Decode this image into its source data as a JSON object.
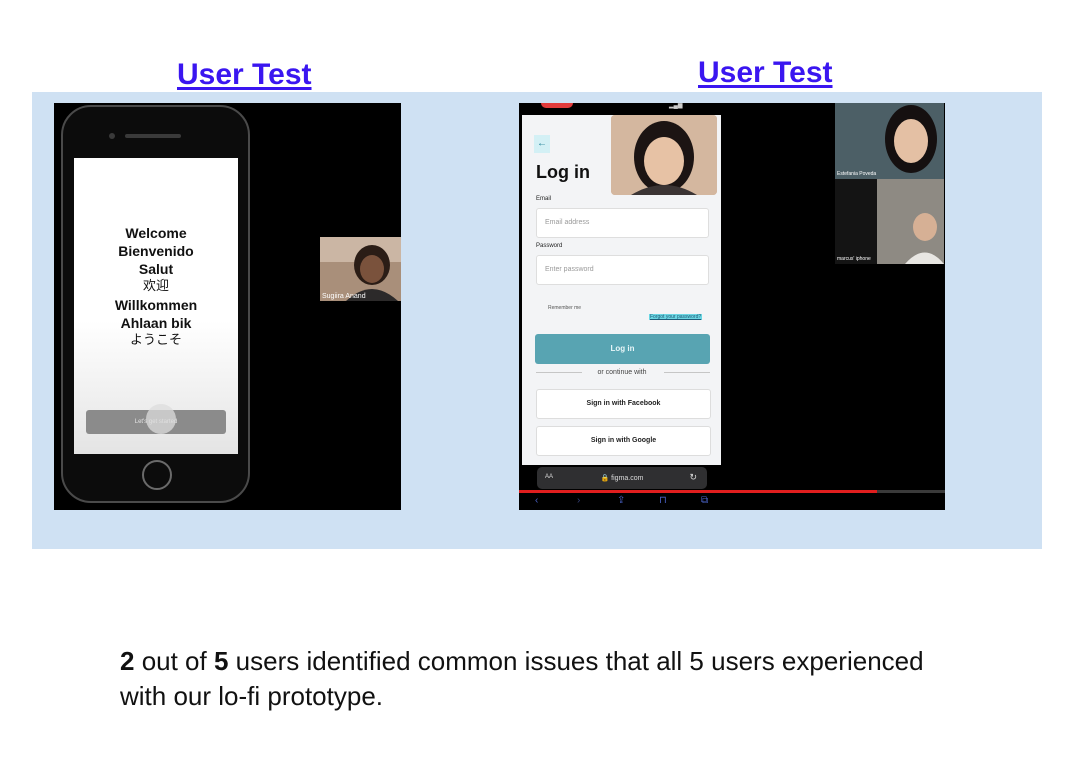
{
  "headings": {
    "left": "User Test",
    "right": "User Test"
  },
  "left_recording": {
    "greetings": [
      "Welcome",
      "Bienvenido",
      "Salut",
      "欢迎",
      "Willkommen",
      "Ahlaan bik",
      "ようこそ"
    ],
    "start_button_label": "Let's get started",
    "participant_name": "Sugiira Anand"
  },
  "right_recording": {
    "login_title": "Log in",
    "back_arrow": "←",
    "email_label": "Email",
    "email_placeholder": "Email address",
    "password_label": "Password",
    "password_placeholder": "Enter password",
    "remember_label": "Remember me",
    "forgot_link": "Forgot your password?",
    "login_button": "Log in",
    "or_continue": "or continue with",
    "facebook_button": "Sign in with Facebook",
    "google_button": "Sign in with Google",
    "address_aa": "AA",
    "url": "🔒 figma.com",
    "participants": [
      "Estefania Poveda",
      "marcus' iphone"
    ],
    "video_progress": 0.84
  },
  "caption": {
    "count_a": "2",
    "text_a": " out of ",
    "count_b": "5",
    "text_b": " users identified common issues that all 5 users experienced with our lo-fi prototype."
  },
  "colors": {
    "link": "#3a16f0",
    "panel": "#cfe1f3",
    "login_button": "#58a4b2",
    "progress": "#e01e1e"
  },
  "icons": [
    "back-arrow-icon",
    "lock-icon",
    "reload-icon",
    "share-icon",
    "bookmarks-icon",
    "tabs-icon"
  ]
}
